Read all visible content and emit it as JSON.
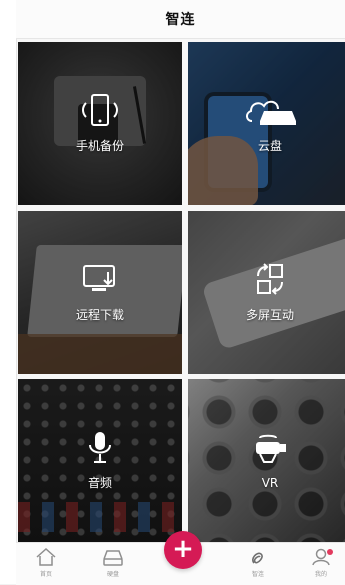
{
  "header": {
    "title": "智连"
  },
  "tiles": [
    {
      "label": "手机备份",
      "icon": "phone-backup-icon"
    },
    {
      "label": "云盘",
      "icon": "cloud-disk-icon"
    },
    {
      "label": "远程下载",
      "icon": "remote-download-icon"
    },
    {
      "label": "多屏互动",
      "icon": "multi-screen-icon"
    },
    {
      "label": "音频",
      "icon": "microphone-icon"
    },
    {
      "label": "VR",
      "icon": "vr-headset-icon"
    }
  ],
  "bottom_nav": {
    "items": [
      {
        "label": "首页",
        "icon": "home-icon"
      },
      {
        "label": "硬盘",
        "icon": "hard-drive-icon"
      },
      {
        "label": "智连",
        "icon": "link-icon"
      },
      {
        "label": "我的",
        "icon": "user-icon"
      }
    ],
    "fab_label": "+"
  },
  "colors": {
    "accent": "#d51a55"
  }
}
